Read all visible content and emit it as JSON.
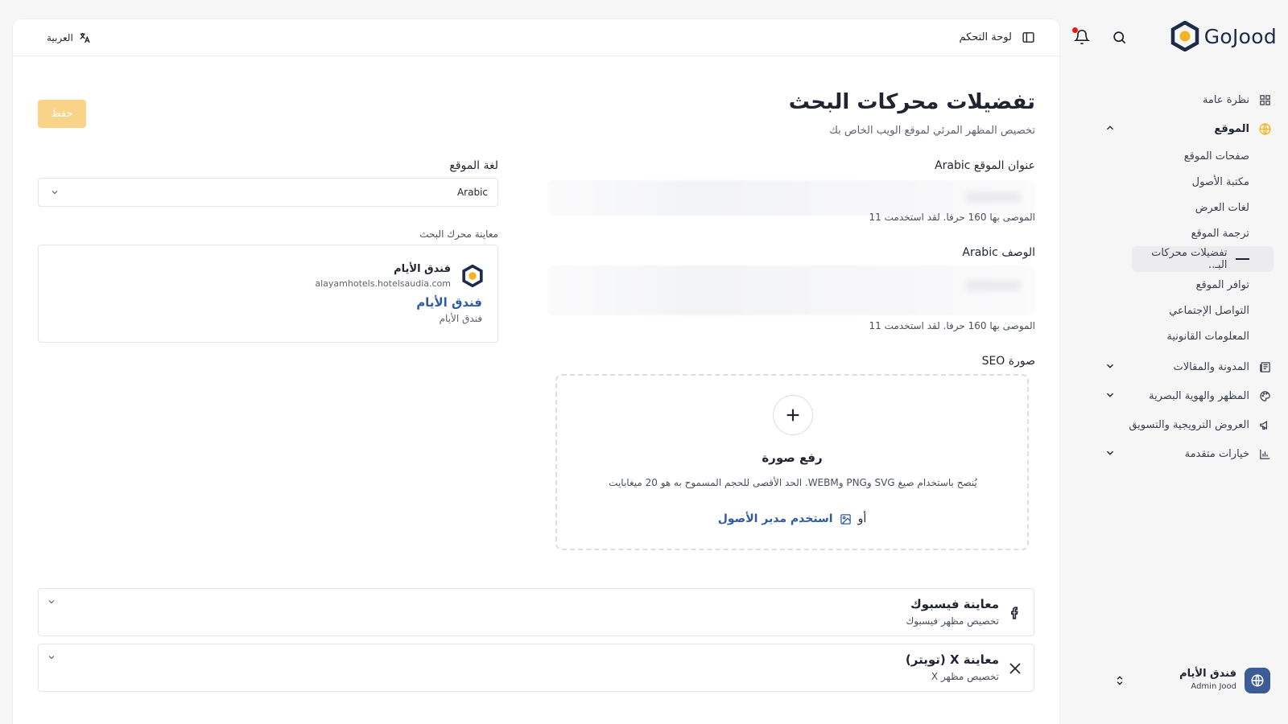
{
  "brand": {
    "name": "GoJood",
    "accent": "#f5b321",
    "navy": "#1e2a4a"
  },
  "sidebar": {
    "items": [
      {
        "label": "نظرة عامة",
        "icon": "grid-icon"
      },
      {
        "label": "الموقع",
        "icon": "globe-icon",
        "expanded": true
      },
      {
        "label": "المدونة والمقالات",
        "icon": "newspaper-icon"
      },
      {
        "label": "المظهر والهوية البصرية",
        "icon": "palette-icon"
      },
      {
        "label": "العروض الترويجية والتسويق",
        "icon": "megaphone-icon"
      },
      {
        "label": "خيارات متقدمة",
        "icon": "chart-icon"
      }
    ],
    "site_children": [
      "صفحات الموقع",
      "مكتبة الأصول",
      "لغات العرض",
      "ترجمة الموقع",
      "تفضيلات محركات البـ..",
      "توافر الموقع",
      "التواصل الإجتماعي",
      "المعلومات القانونية"
    ],
    "user": {
      "name": "فندق الأيام",
      "role": "Admin Jood"
    }
  },
  "topbar": {
    "breadcrumb": "لوحة التحكم",
    "language": "العربية"
  },
  "page": {
    "title": "تفضيلات محركات البحث",
    "subtitle": "تخصيص المظهر المرئي لموقع الويب الخاص بك",
    "save_label": "حفظ"
  },
  "form": {
    "site_title_label": "عنوان الموقع Arabic",
    "site_title_hint": "الموصى بها 160 حرفا. لقد استخدمت 11",
    "description_label": "الوصف Arabic",
    "description_hint": "الموصى بها 160 حرفا. لقد استخدمت 11",
    "seo_image_label": "صورة SEO",
    "site_language_label": "لغة الموقع",
    "site_language_value": "Arabic"
  },
  "search_preview": {
    "label": "معاينة محرك البحث",
    "site_name": "فندق الأيام",
    "url": "alayamhotels.hotelsaudia.com",
    "title": "فندق الأيام",
    "description": "فندق الأيام"
  },
  "upload": {
    "title": "رفع صورة",
    "note": "يُنصح باستخدام صيغ SVG وPNG وWEBM. الحد الأقصى للحجم المسموح به هو 20 ميغابايت",
    "or": "أو",
    "asset_link": "استخدم مدير الأصول"
  },
  "accordions": [
    {
      "title": "معاينة فيسبوك",
      "subtitle": "تخصيص مظهر فيسبوك",
      "icon": "facebook-icon"
    },
    {
      "title": "معاينة X (تويتر)",
      "subtitle": "تخصيص مظهر X",
      "icon": "x-icon"
    }
  ]
}
